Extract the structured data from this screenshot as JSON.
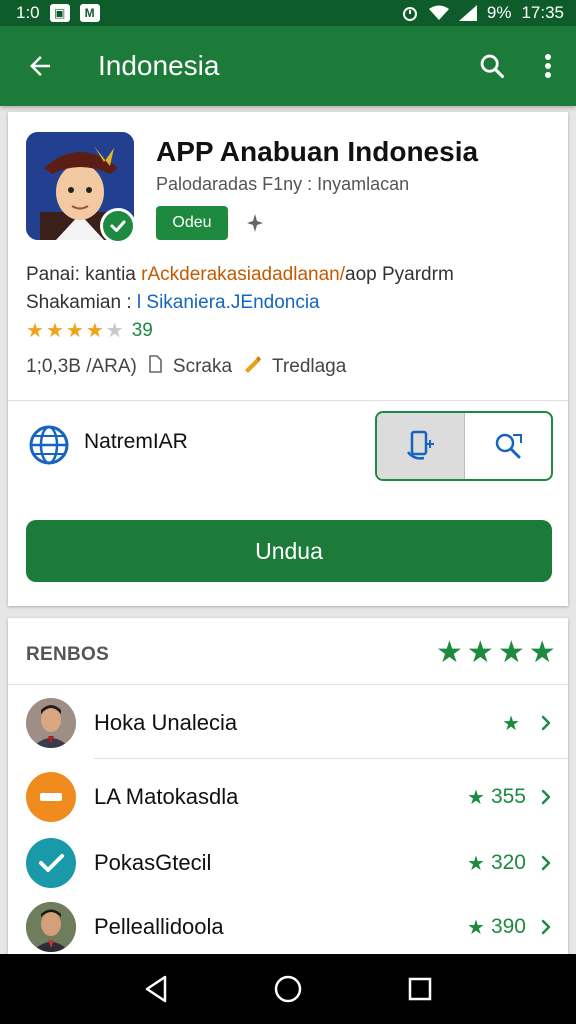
{
  "status_bar": {
    "left_time": "1:0",
    "battery": "9%",
    "clock": "17:35"
  },
  "app_bar": {
    "title": "Indonesia"
  },
  "app": {
    "title": "APP Anabuan Indonesia",
    "subtitle": "Palodaradas F1ny : Inyamlacan",
    "tag_label": "Odeu",
    "info1_prefix": "Panai: kantia ",
    "info1_highlight": "rAckderakasiadadlanan/",
    "info1_suffix": "aop Pyardrm",
    "info2_prefix": "Shakamian : ",
    "info2_highlight": "l Sikaniera.JEndoncia",
    "rating_value": "39",
    "rating_stars": 3.5,
    "size_label": "1;0,3B /ARA)",
    "category_label": "Scraka",
    "feature_label": "Tredlaga"
  },
  "network": {
    "label": "NatremIAR"
  },
  "install_button": {
    "label": "Undua"
  },
  "reviews": {
    "header": "RENBOS",
    "items": [
      {
        "name": "Hoka Unalecia",
        "score": ""
      },
      {
        "name": "LA Matokasdla",
        "score": "355"
      },
      {
        "name": "PokasGtecil",
        "score": "320"
      },
      {
        "name": "Pelleallidoola",
        "score": "390"
      }
    ]
  },
  "colors": {
    "primary": "#1d7b3a",
    "status_bar": "#0f5c2b",
    "accent_green": "#1d8a3f",
    "star_orange": "#f0a31a"
  }
}
